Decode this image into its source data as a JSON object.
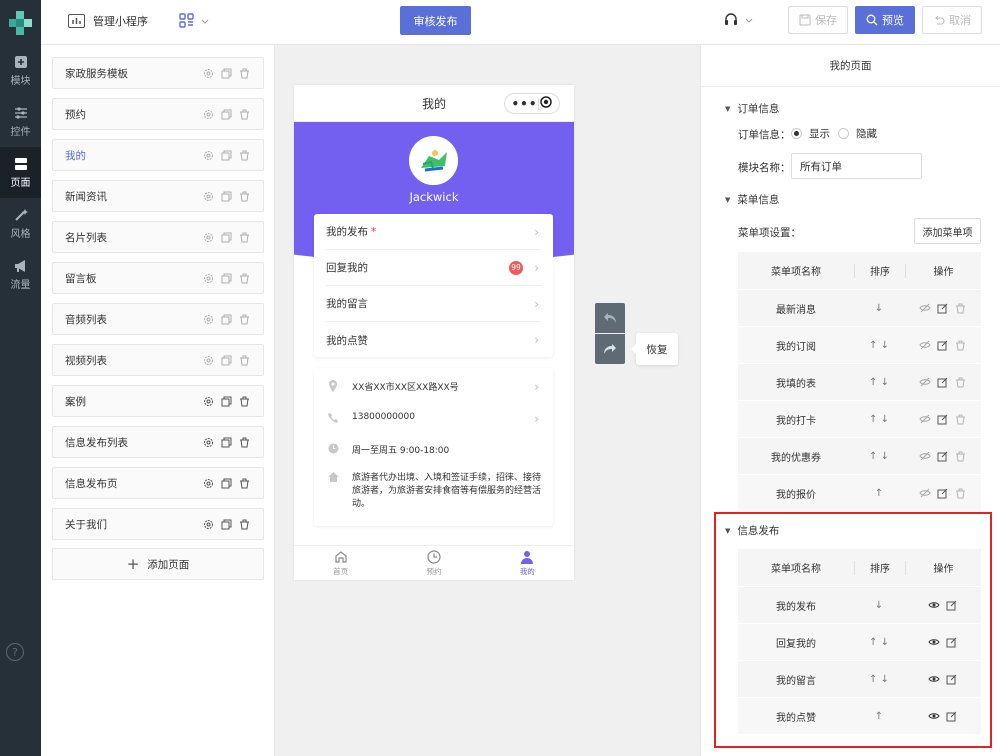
{
  "app": {
    "name": "管理小程序"
  },
  "topbar": {
    "publish_label": "审核发布",
    "save_label": "保存",
    "preview_label": "预览",
    "cancel_label": "取消"
  },
  "leftnav": {
    "items": [
      {
        "label": "模块",
        "icon": "plus-square-icon"
      },
      {
        "label": "控件",
        "icon": "sliders-icon"
      },
      {
        "label": "页面",
        "icon": "pages-icon",
        "active": true
      },
      {
        "label": "风格",
        "icon": "magic-wand-icon"
      },
      {
        "label": "流量",
        "icon": "megaphone-icon"
      }
    ]
  },
  "pages": {
    "items": [
      {
        "label": "家政服务模板"
      },
      {
        "label": "预约"
      },
      {
        "label": "我的",
        "active": true
      },
      {
        "label": "新闻资讯"
      },
      {
        "label": "名片列表"
      },
      {
        "label": "留言板"
      },
      {
        "label": "音频列表"
      },
      {
        "label": "视频列表"
      },
      {
        "label": "案例"
      },
      {
        "label": "信息发布列表"
      },
      {
        "label": "信息发布页"
      },
      {
        "label": "关于我们"
      }
    ],
    "add_label": "添加页面"
  },
  "phone": {
    "title": "我的",
    "username": "Jackwick",
    "menu": [
      {
        "label": "我的发布",
        "required": "*"
      },
      {
        "label": "回复我的",
        "badge": "99"
      },
      {
        "label": "我的留言"
      },
      {
        "label": "我的点赞"
      }
    ],
    "info": {
      "address": "XX省XX市XX区XX路XX号",
      "phone": "13800000000",
      "hours": "周一至周五 9:00-18:00",
      "desc": "旅游者代办出境、入境和签证手续，招徕、接待旅游者，为旅游者安排食宿等有偿服务的经营活动。"
    },
    "tabs": [
      {
        "label": "首页"
      },
      {
        "label": "预约"
      },
      {
        "label": "我的",
        "active": true
      }
    ]
  },
  "redo_tip": "恢复",
  "rpanel": {
    "title": "我的页面",
    "order_section": "订单信息",
    "order_label": "订单信息：",
    "show_label": "显示",
    "hide_label": "隐藏",
    "module_name_label": "模块名称：",
    "module_name_value": "所有订单",
    "menu_section": "菜单信息",
    "menu_setting_label": "菜单项设置：",
    "add_menu_label": "添加菜单项",
    "col_name": "菜单项名称",
    "col_sort": "排序",
    "col_ops": "操作",
    "menu_rows": [
      {
        "name": "最新消息",
        "sort": "↓"
      },
      {
        "name": "我的订阅",
        "sort": "↑ ↓"
      },
      {
        "name": "我填的表",
        "sort": "↑ ↓"
      },
      {
        "name": "我的打卡",
        "sort": "↑ ↓"
      },
      {
        "name": "我的优惠券",
        "sort": "↑ ↓"
      },
      {
        "name": "我的报价",
        "sort": "↑"
      }
    ],
    "info_section": "信息发布",
    "info_rows": [
      {
        "name": "我的发布",
        "sort": "↓"
      },
      {
        "name": "回复我的",
        "sort": "↑ ↓"
      },
      {
        "name": "我的留言",
        "sort": "↑ ↓"
      },
      {
        "name": "我的点赞",
        "sort": "↑"
      }
    ]
  },
  "colors": {
    "accent": "#5b6fd9",
    "phone_accent": "#7460f0",
    "highlight": "#e02424",
    "nav_bg": "#263038"
  }
}
